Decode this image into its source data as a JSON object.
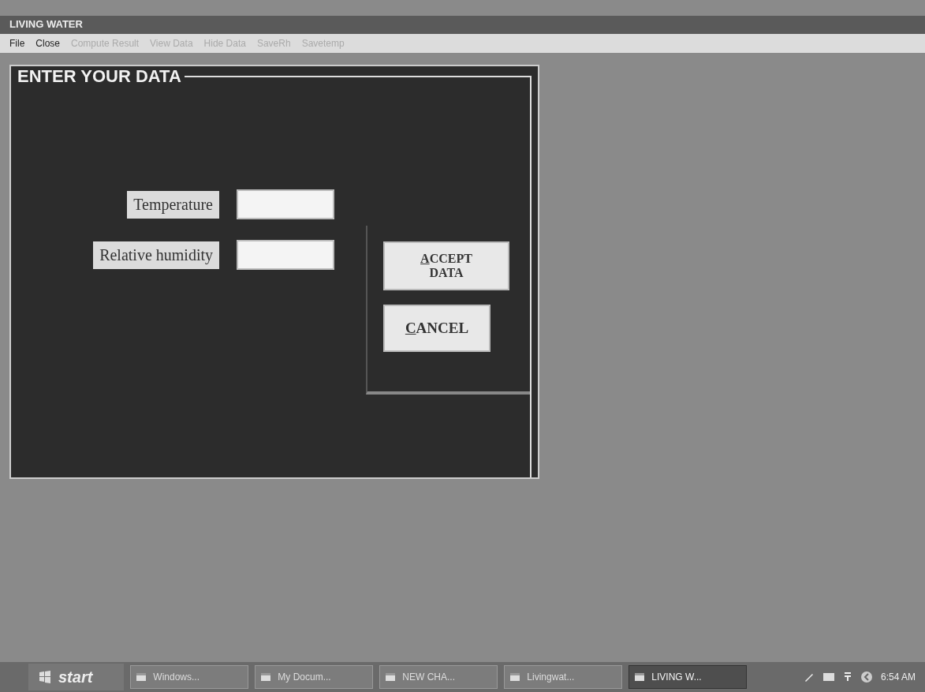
{
  "window": {
    "title": "LIVING WATER"
  },
  "menu": [
    {
      "label": "File",
      "disabled": false
    },
    {
      "label": "Close",
      "disabled": false
    },
    {
      "label": "Compute Result",
      "disabled": true
    },
    {
      "label": "View Data",
      "disabled": true
    },
    {
      "label": "Hide Data",
      "disabled": true
    },
    {
      "label": "SaveRh",
      "disabled": true
    },
    {
      "label": "Savetemp",
      "disabled": true
    }
  ],
  "frame": {
    "title": "ENTER YOUR DATA"
  },
  "fields": [
    {
      "label": "Temperature"
    },
    {
      "label": "Relative humidity"
    }
  ],
  "buttons": [
    {
      "label": "ACCEPT DATA"
    },
    {
      "label": "CANCEL"
    }
  ],
  "taskbar": {
    "start": "start",
    "items": [
      {
        "label": "Windows...",
        "selected": false
      },
      {
        "label": "My Docum...",
        "selected": false
      },
      {
        "label": "NEW CHA...",
        "selected": false
      },
      {
        "label": "Livingwat...",
        "selected": false
      },
      {
        "label": "LIVING W...",
        "selected": true
      }
    ],
    "clock": "6:54 AM"
  }
}
